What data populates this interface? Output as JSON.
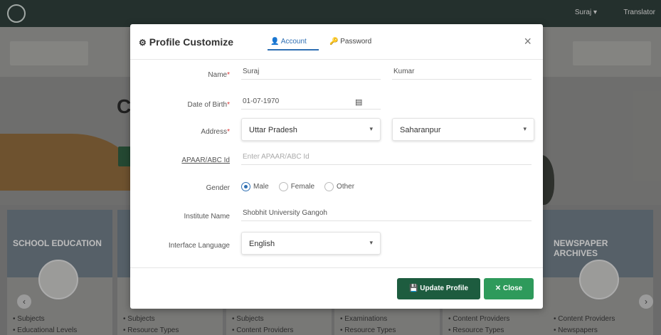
{
  "background": {
    "nav": {
      "user": "Suraj ▾",
      "language": "Translator"
    },
    "hero": {
      "title": "C"
    },
    "cards": [
      {
        "title": "SCHOOL EDUCATION",
        "links": [
          "• Subjects",
          "• Educational Levels"
        ]
      },
      {
        "title": "",
        "links": [
          "• Subjects",
          "• Resource Types"
        ]
      },
      {
        "title": "",
        "links": [
          "• Subjects",
          "• Content Providers"
        ]
      },
      {
        "title": "",
        "links": [
          "• Examinations",
          "• Resource Types"
        ]
      },
      {
        "title": "",
        "links": [
          "• Content Providers",
          "• Resource Types"
        ]
      },
      {
        "title": "NEWSPAPER ARCHIVES",
        "links": [
          "• Content Providers",
          "• Newspapers"
        ]
      }
    ],
    "arrows": {
      "left": "‹",
      "right": "›"
    }
  },
  "modal": {
    "title": "Profile Customize",
    "tabs": {
      "account": "Account",
      "password": "Password"
    },
    "close_icon": "×",
    "form": {
      "name_label": "Name",
      "first_name": "Suraj",
      "last_name": "Kumar",
      "dob_label": "Date of Birth",
      "dob_value": "01-07-1970",
      "address_label": "Address",
      "state": "Uttar Pradesh",
      "district": "Saharanpur",
      "apaar_label": "APAAR/ABC Id",
      "apaar_placeholder": "Enter APAAR/ABC Id",
      "gender_label": "Gender",
      "gender_options": [
        "Male",
        "Female",
        "Other"
      ],
      "gender_selected": "Male",
      "institute_label": "Institute Name",
      "institute_value": "Shobhit University Gangoh",
      "language_label": "Interface Language",
      "language_value": "English",
      "required_mark": "*"
    },
    "buttons": {
      "update": "Update Profile",
      "close": "Close"
    }
  },
  "colors": {
    "primary_dark": "#1d5c3f",
    "primary": "#2e9a5b",
    "tab_active": "#2f6fb3"
  }
}
